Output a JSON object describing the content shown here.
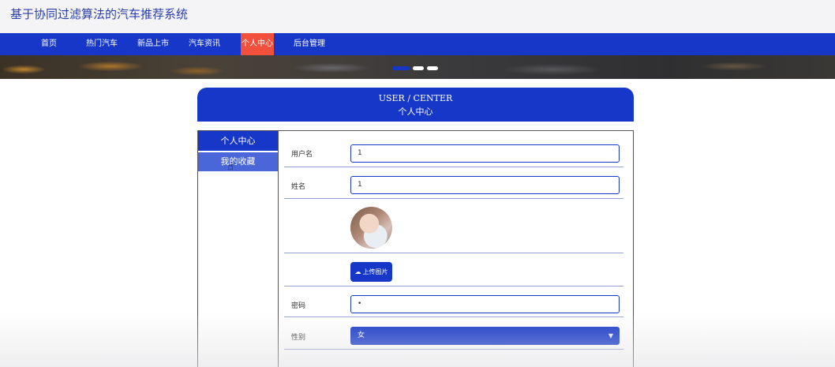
{
  "site": {
    "title": "基于协同过滤算法的汽车推荐系统"
  },
  "nav": {
    "items": [
      {
        "label": "首页"
      },
      {
        "label": "热门汽车"
      },
      {
        "label": "新品上市"
      },
      {
        "label": "汽车资讯"
      },
      {
        "label": "个人中心",
        "active": true
      },
      {
        "label": "后台管理"
      }
    ]
  },
  "banner": {
    "slides": 3,
    "active_slide": 1
  },
  "center": {
    "title_en": "USER / CENTER",
    "title_cn": "个人中心"
  },
  "sidebar": {
    "header": "个人中心",
    "items": [
      {
        "label": "我的收藏"
      }
    ]
  },
  "form": {
    "username": {
      "label": "用户名",
      "value": "1"
    },
    "name": {
      "label": "姓名",
      "value": "1"
    },
    "avatar": {
      "upload_label": "上传图片"
    },
    "password": {
      "label": "密码",
      "value": "•"
    },
    "gender": {
      "label": "性别",
      "value": "女"
    }
  },
  "colors": {
    "primary": "#1637c8",
    "active_nav": "#f0503c",
    "sidebar_item": "#4a66d8"
  }
}
